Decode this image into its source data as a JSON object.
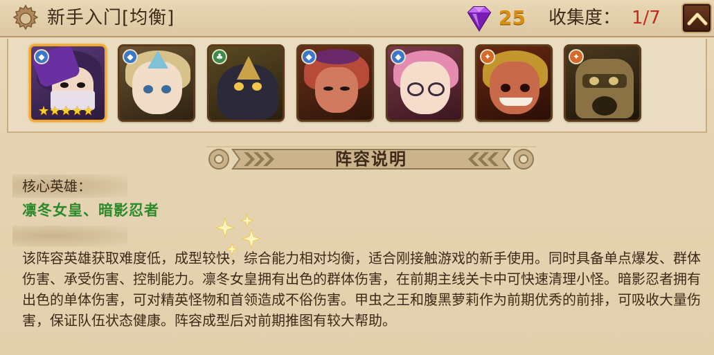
{
  "header": {
    "title": "新手入门[均衡]",
    "gem_count": "25",
    "collect_label": "收集度：",
    "collect_value": "1/7",
    "gem_color": "#9b2bd6",
    "gem_count_color": "#d88e12",
    "collect_value_color": "#c42a1c"
  },
  "heroes": [
    {
      "faction_icon": "water-faction-icon",
      "stars": "★★★★★",
      "highlighted": true
    },
    {
      "faction_icon": "water-faction-icon",
      "stars": ""
    },
    {
      "faction_icon": "nature-faction-icon",
      "stars": ""
    },
    {
      "faction_icon": "water-faction-icon",
      "stars": ""
    },
    {
      "faction_icon": "water-faction-icon",
      "stars": ""
    },
    {
      "faction_icon": "fire-faction-icon",
      "stars": ""
    },
    {
      "faction_icon": "fire-faction-icon",
      "stars": ""
    }
  ],
  "section": {
    "banner_title": "阵容说明",
    "core_label": "核心英雄：",
    "core_heroes": "凛冬女皇、暗影忍者",
    "core_heroes_color": "#2a8a2a",
    "description": "该阵容英雄获取难度低，成型较快，综合能力相对均衡，适合刚接触游戏的新手使用。同时具备单点爆发、群体伤害、承受伤害、控制能力。凛冬女皇拥有出色的群体伤害，在前期主线关卡中可快速清理小怪。暗影忍者拥有出色的单体伤害，可对精英怪物和首领造成不俗伤害。甲虫之王和腹黑萝莉作为前期优秀的前排，可吸收大量伤害，保证队伍状态健康。阵容成型后对前期推图有较大帮助。"
  }
}
